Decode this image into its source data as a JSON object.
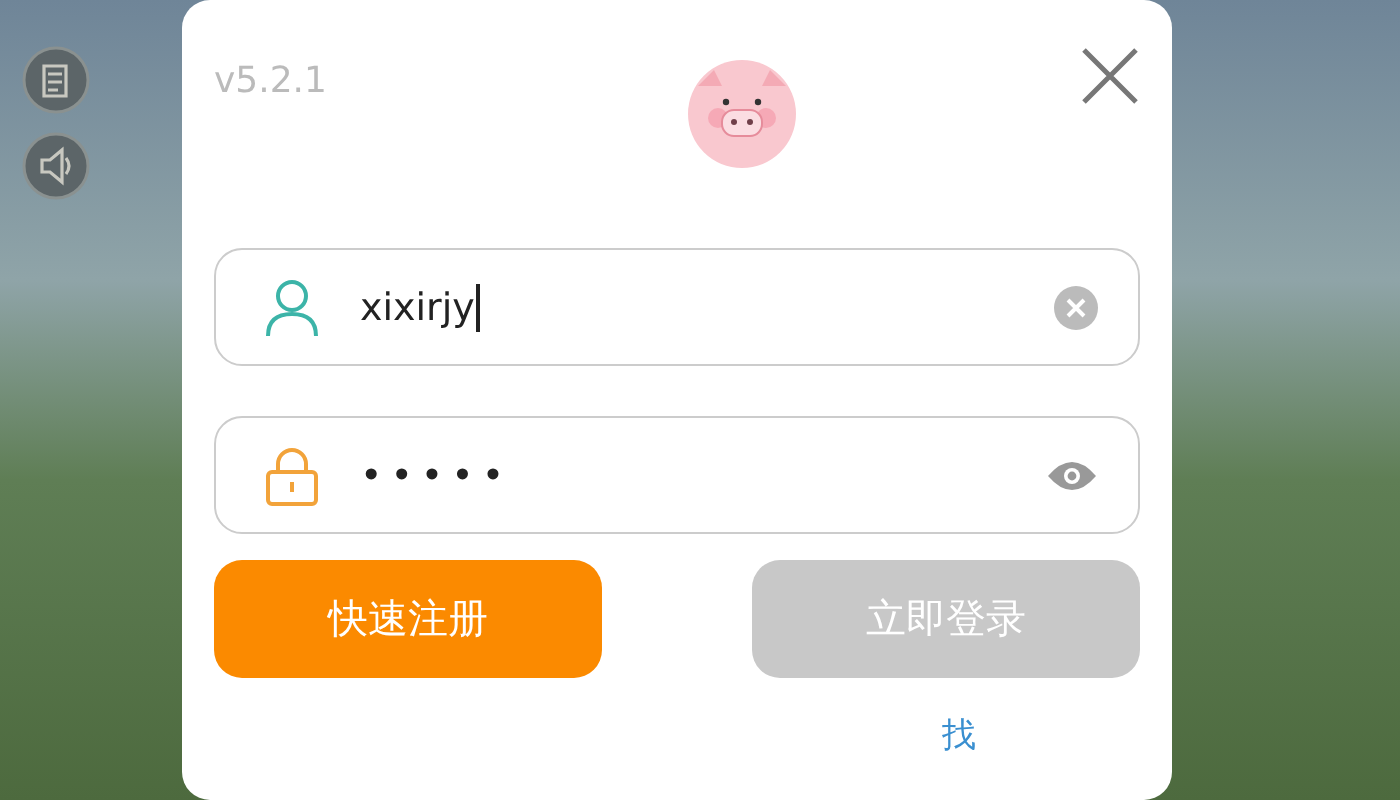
{
  "dialog": {
    "version": "v5.2.1",
    "username": {
      "value": "xixirjy",
      "focused": true
    },
    "password": {
      "value": "•••••",
      "masked": true
    },
    "buttons": [
      {
        "label": "快速注册",
        "kind": "primary"
      },
      {
        "label": "立即登录",
        "kind": "secondary"
      }
    ],
    "link": "找"
  }
}
